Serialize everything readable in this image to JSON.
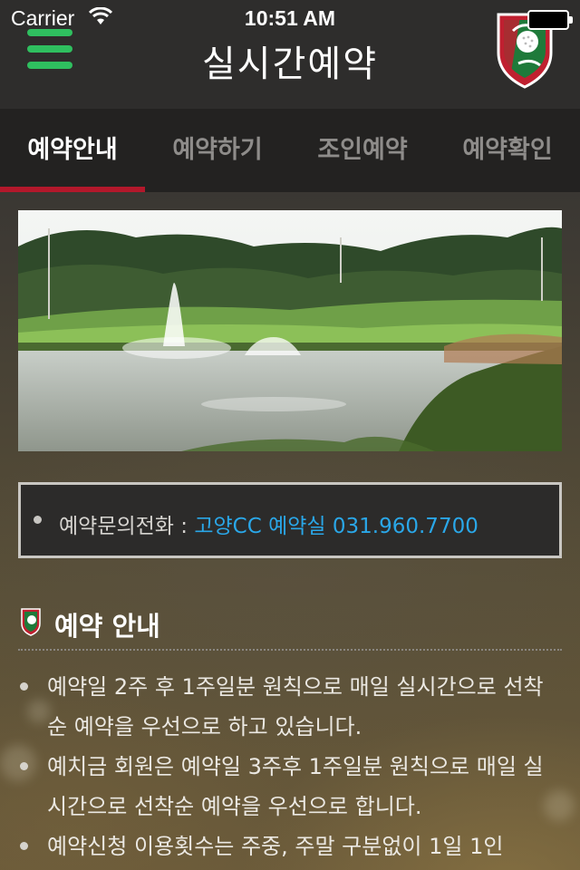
{
  "status_bar": {
    "carrier": "Carrier",
    "time": "10:51 AM"
  },
  "header": {
    "title": "실시간예약",
    "menu_icon": "hamburger-menu-icon",
    "logo_icon": "golf-club-shield-logo"
  },
  "tabs": [
    {
      "label": "예약안내",
      "active": true
    },
    {
      "label": "예약하기",
      "active": false
    },
    {
      "label": "조인예약",
      "active": false
    },
    {
      "label": "예약확인",
      "active": false
    }
  ],
  "contact": {
    "label": "예약문의전화 : ",
    "value": "고양CC 예약실 031.960.7700"
  },
  "section": {
    "title": "예약 안내",
    "items": [
      "예약일 2주 후 1주일분 원칙으로 매일 실시간으로 선착순 예약을 우선으로 하고 있습니다.",
      "예치금 회원은 예약일 3주후 1주일분 원칙으로 매일 실시간으로 선착순 예약을 우선으로 합니다.",
      "예약신청 이용횟수는 주중, 주말 구분없이 1일 1인"
    ]
  },
  "colors": {
    "accent_green": "#2fbf5f",
    "tab_underline": "#b3182b",
    "link_blue": "#2aa7e8"
  }
}
